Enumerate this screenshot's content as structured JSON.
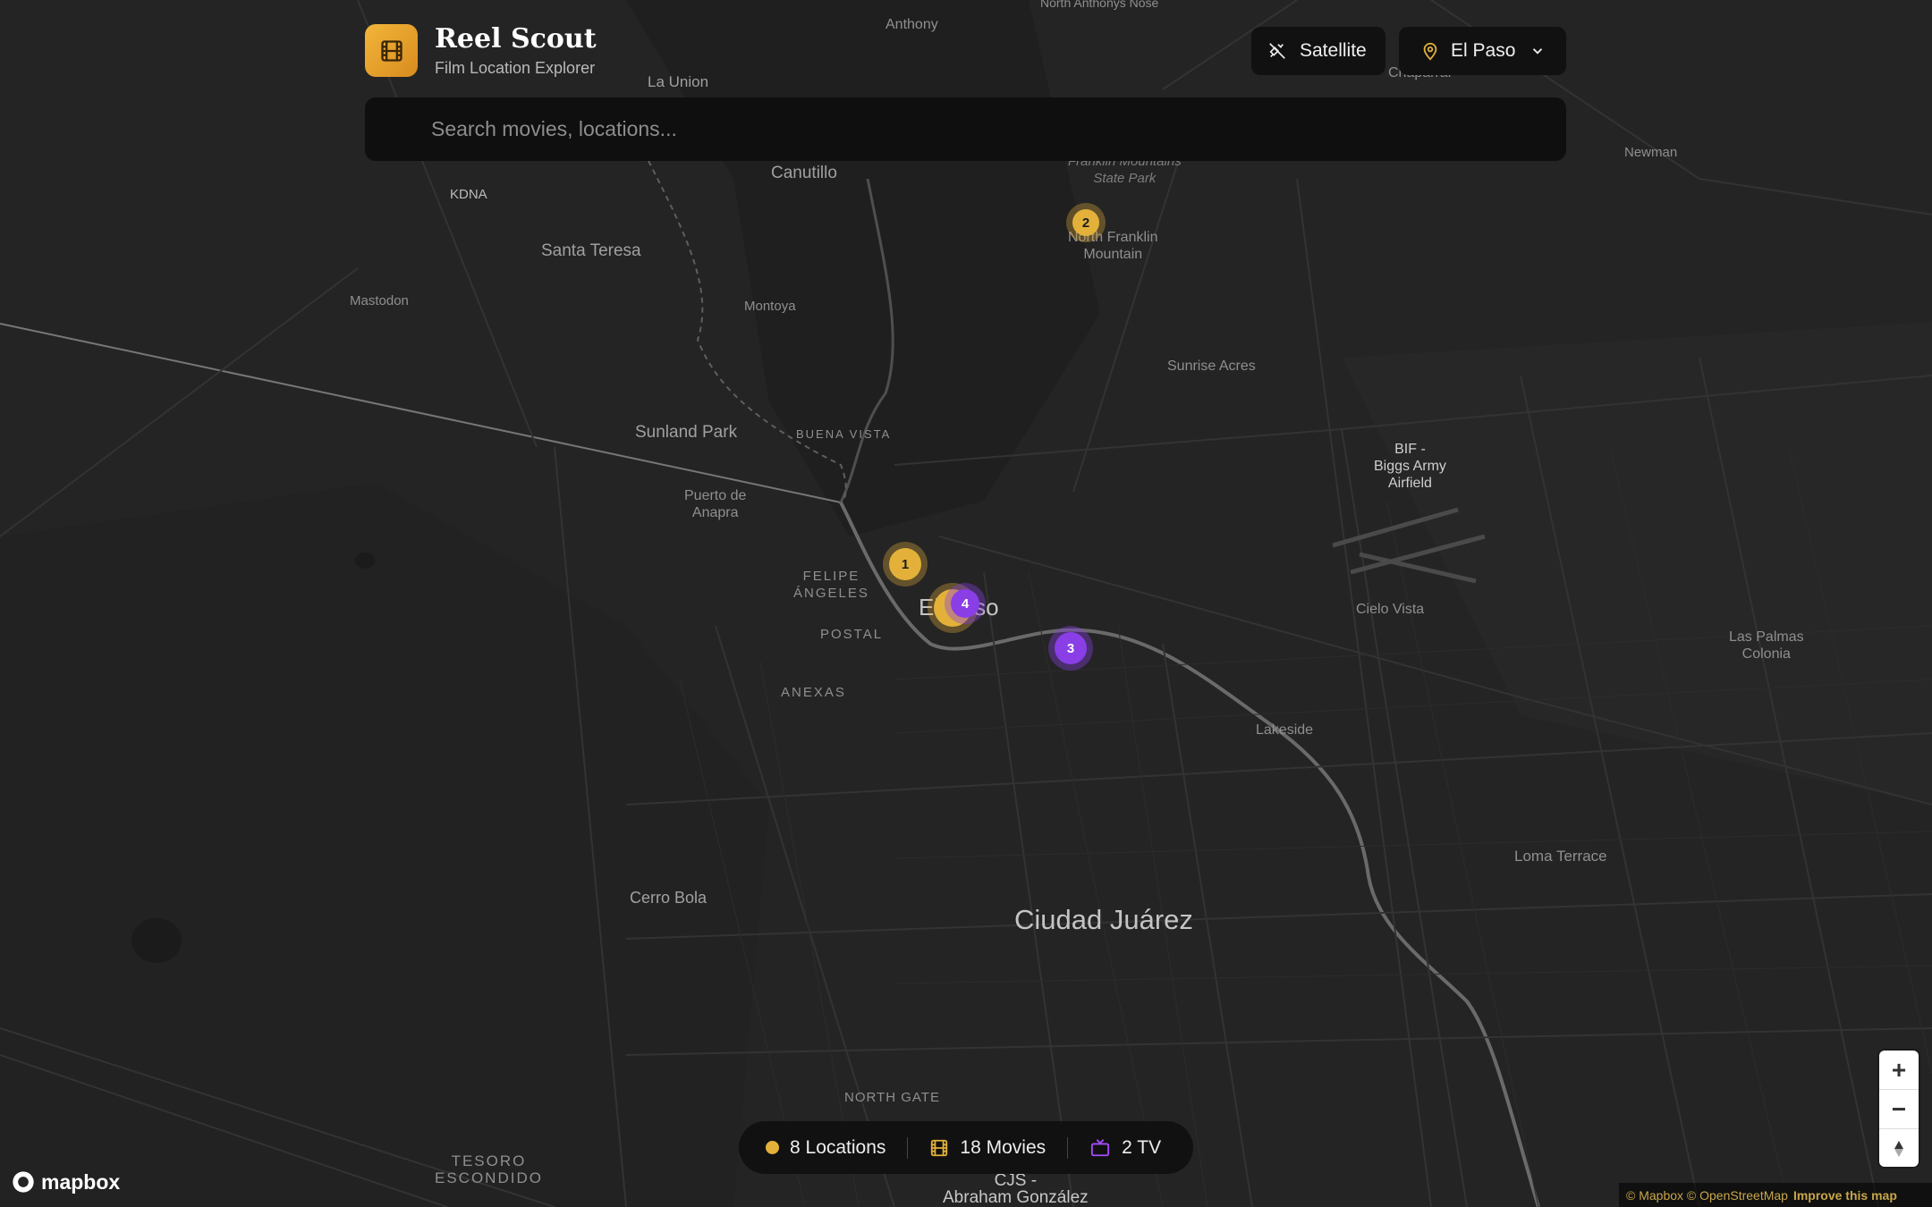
{
  "app": {
    "title": "Reel Scout",
    "subtitle": "Film Location Explorer",
    "logo_icon": "film-icon"
  },
  "header": {
    "satellite_label": "Satellite",
    "satellite_icon": "satellite-off-icon",
    "city_label": "El Paso",
    "city_icon": "map-pin-icon"
  },
  "search": {
    "placeholder": "Search movies, locations..."
  },
  "map": {
    "labels": {
      "anthony": "Anthony",
      "north_anthonys_nose": "North Anthonys Nose",
      "chaparral": "Chaparral",
      "la_union": "La Union",
      "newman": "Newman",
      "franklin_park": "Franklin Mountains\nState Park",
      "canutillo": "Canutillo",
      "kdna": "KDNA",
      "north_franklin": "North Franklin\nMountain",
      "santa_teresa": "Santa Teresa",
      "mastodon": "Mastodon",
      "montoya": "Montoya",
      "sunrise_acres": "Sunrise Acres",
      "sunland_park": "Sunland Park",
      "buena_vista": "BUENA VISTA",
      "bif": "BIF -\nBiggs Army\nAirfield",
      "puerto_anapra": "Puerto de\nAnapra",
      "felipe_angeles": "FELIPE\nÁNGELES",
      "el_paso": "El Paso",
      "cielo_vista": "Cielo Vista",
      "las_palmas": "Las Palmas\nColonia",
      "postal": "POSTAL",
      "anexas": "ANEXAS",
      "lakeside": "Lakeside",
      "loma_terrace": "Loma Terrace",
      "cerro_bola": "Cerro Bola",
      "ciudad_juarez": "Ciudad Juárez",
      "north_gate": "NORTH GATE",
      "tesoro": "TESORO\nESCONDIDO",
      "cjs": "CJS -\nAbraham González"
    },
    "markers": [
      {
        "label": "1",
        "type": "movie",
        "color": "#e3b13a"
      },
      {
        "label": "2",
        "type": "movie",
        "color": "#e3b13a"
      },
      {
        "label": "3",
        "type": "tv",
        "color": "#8a3ee6"
      },
      {
        "label": "4",
        "type": "tv",
        "color": "#8a3ee6"
      }
    ]
  },
  "stats": {
    "locations": "8 Locations",
    "movies": "18 Movies",
    "tv": "2 TV",
    "location_color": "#e3b13a",
    "movie_color": "#e3b13a",
    "tv_color": "#a64dff"
  },
  "controls": {
    "zoom_in": "+",
    "zoom_out": "−",
    "compass_icon": "compass-icon"
  },
  "footer": {
    "mapbox_logo": "mapbox",
    "attribution": "© Mapbox © OpenStreetMap",
    "improve": "Improve this map"
  }
}
